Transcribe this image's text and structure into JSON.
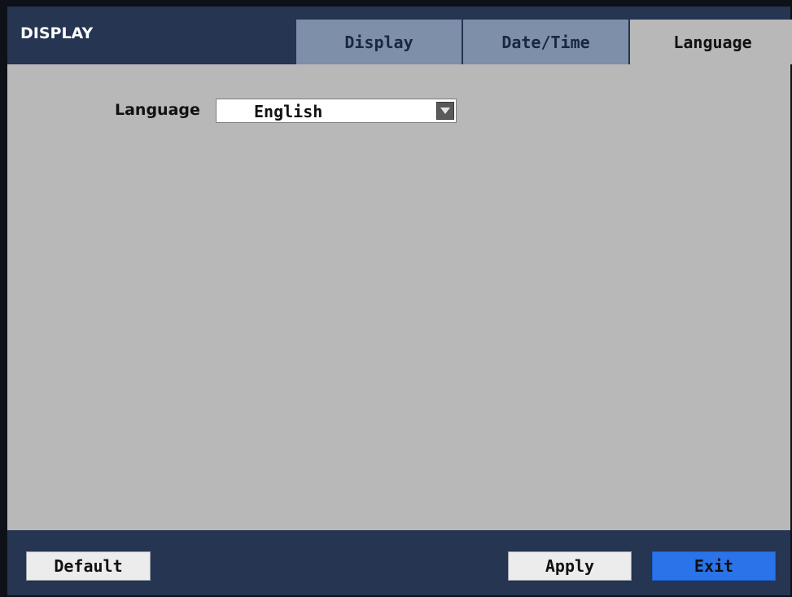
{
  "window": {
    "title": "DISPLAY"
  },
  "tabs": [
    {
      "label": "Display",
      "active": false
    },
    {
      "label": "Date/Time",
      "active": false
    },
    {
      "label": "Language",
      "active": true
    }
  ],
  "language_setting": {
    "label": "Language",
    "selected": "English"
  },
  "footer": {
    "default_label": "Default",
    "apply_label": "Apply",
    "exit_label": "Exit"
  },
  "colors": {
    "header_bg": "#253552",
    "content_bg": "#b8b8b8",
    "inactive_tab_bg": "#7d8fa9",
    "exit_button_bg": "#2a73e8"
  },
  "icons": {
    "dropdown": "chevron-down-icon"
  }
}
